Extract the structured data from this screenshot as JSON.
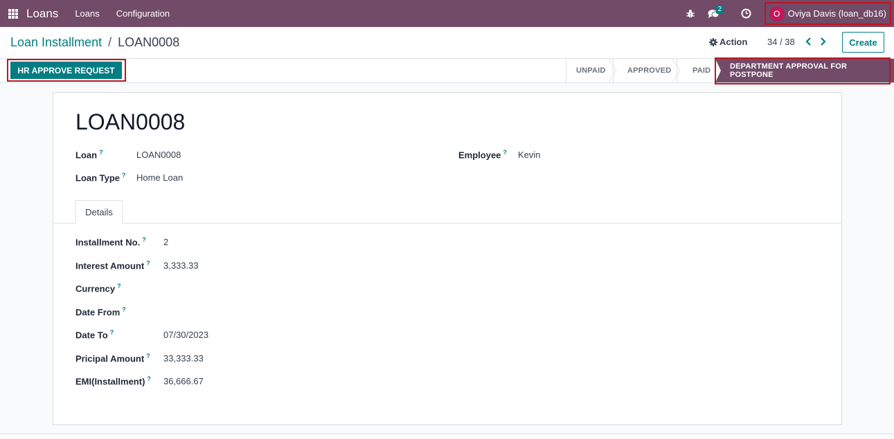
{
  "navbar": {
    "app_name": "Loans",
    "menu": [
      "Loans",
      "Configuration"
    ],
    "messages_badge": "2",
    "user_initial": "O",
    "user_name": "Oviya Davis (loan_db16)"
  },
  "control": {
    "breadcrumb_parent": "Loan Installment",
    "breadcrumb_separator": "/",
    "breadcrumb_current": "LOAN0008",
    "action_label": "Action",
    "pager": "34 / 38",
    "create_label": "Create"
  },
  "statusbar": {
    "primary_button": "HR APPROVE REQUEST",
    "stages": [
      "UNPAID",
      "APPROVED",
      "PAID",
      "DEPARTMENT APPROVAL FOR POSTPONE"
    ],
    "active_stage": "DEPARTMENT APPROVAL FOR POSTPONE"
  },
  "form": {
    "title": "LOAN0008",
    "help_marker": "?",
    "loan_label": "Loan",
    "loan_value": "LOAN0008",
    "loan_type_label": "Loan Type",
    "loan_type_value": "Home Loan",
    "employee_label": "Employee",
    "employee_value": "Kevin",
    "tab_details": "Details",
    "details": [
      {
        "label": "Installment No.",
        "value": "2"
      },
      {
        "label": "Interest Amount",
        "value": "3,333.33"
      },
      {
        "label": "Currency",
        "value": ""
      },
      {
        "label": "Date From",
        "value": ""
      },
      {
        "label": "Date To",
        "value": "07/30/2023"
      },
      {
        "label": "Pricipal Amount",
        "value": "33,333.33"
      },
      {
        "label": "EMI(Installment)",
        "value": "36,666.67"
      }
    ]
  },
  "colors": {
    "brand": "#714b67",
    "accent": "#017e84",
    "highlight_border": "#c0141d"
  }
}
